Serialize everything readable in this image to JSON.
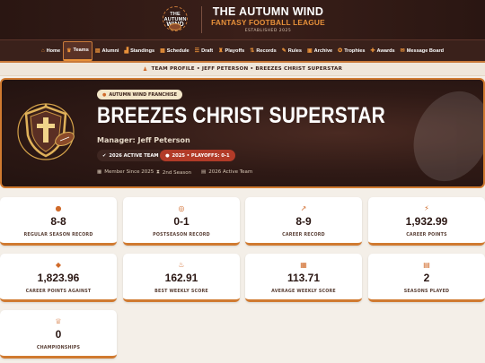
{
  "brand": {
    "logo_line1": "THE AUTUMN",
    "logo_line2": "WIND",
    "title": "THE AUTUMN WIND",
    "subtitle": "FANTASY FOOTBALL LEAGUE",
    "established": "ESTABLISHED 2025"
  },
  "nav": {
    "items": [
      {
        "label": "Home",
        "icon": "home-icon",
        "glyph": "⌂",
        "active": false
      },
      {
        "label": "Teams",
        "icon": "teams-icon",
        "glyph": "♛",
        "active": true
      },
      {
        "label": "Alumni",
        "icon": "alumni-icon",
        "glyph": "▤",
        "active": false
      },
      {
        "label": "Standings",
        "icon": "standings-icon",
        "glyph": "▟",
        "active": false
      },
      {
        "label": "Schedule",
        "icon": "schedule-icon",
        "glyph": "▦",
        "active": false
      },
      {
        "label": "Draft",
        "icon": "draft-icon",
        "glyph": "☰",
        "active": false
      },
      {
        "label": "Playoffs",
        "icon": "playoffs-icon",
        "glyph": "♜",
        "active": false
      },
      {
        "label": "Records",
        "icon": "records-icon",
        "glyph": "⇅",
        "active": false
      },
      {
        "label": "Rules",
        "icon": "rules-icon",
        "glyph": "✎",
        "active": false
      },
      {
        "label": "Archive",
        "icon": "archive-icon",
        "glyph": "▣",
        "active": false
      },
      {
        "label": "Trophies",
        "icon": "trophies-icon",
        "glyph": "✪",
        "active": false
      },
      {
        "label": "Awards",
        "icon": "awards-icon",
        "glyph": "✚",
        "active": false
      },
      {
        "label": "Message Board",
        "icon": "message-board-icon",
        "glyph": "✉",
        "active": false
      }
    ]
  },
  "breadcrumb": {
    "icon": "user-icon",
    "text": "TEAM PROFILE • JEFF PETERSON • BREEZES CHRIST SUPERSTAR"
  },
  "hero": {
    "franchise_label": "AUTUMN WIND FRANCHISE",
    "team_name": "BREEZES CHRIST SUPERSTAR",
    "manager": "Manager: Jeff Peterson",
    "active_badge": "2026 ACTIVE TEAM",
    "playoffs_badge": "2025 • PLAYOFFS: 0-1",
    "member_since": "Member Since 2025",
    "season": "2nd Season",
    "active_team": "2026 Active Team"
  },
  "stats": [
    {
      "icon": "football-icon",
      "glyph": "●",
      "value": "8-8",
      "label": "REGULAR SEASON RECORD"
    },
    {
      "icon": "medal-icon",
      "glyph": "◎",
      "value": "0-1",
      "label": "POSTSEASON RECORD"
    },
    {
      "icon": "chart-line-icon",
      "glyph": "↗",
      "value": "8-9",
      "label": "CAREER RECORD"
    },
    {
      "icon": "bolt-icon",
      "glyph": "⚡",
      "value": "1,932.99",
      "label": "CAREER POINTS"
    },
    {
      "icon": "shield-icon",
      "glyph": "◆",
      "value": "1,823.96",
      "label": "CAREER POINTS AGAINST"
    },
    {
      "icon": "fire-icon",
      "glyph": "♨",
      "value": "162.91",
      "label": "BEST WEEKLY SCORE"
    },
    {
      "icon": "calculator-icon",
      "glyph": "▦",
      "value": "113.71",
      "label": "AVERAGE WEEKLY SCORE"
    },
    {
      "icon": "calendar-icon",
      "glyph": "▤",
      "value": "2",
      "label": "SEASONS PLAYED"
    },
    {
      "icon": "trophy-icon",
      "glyph": "♕",
      "value": "0",
      "label": "CHAMPIONSHIPS"
    }
  ],
  "colors": {
    "accent": "#d07a30",
    "dark": "#2e1915",
    "playoffs": "#b23b28"
  }
}
